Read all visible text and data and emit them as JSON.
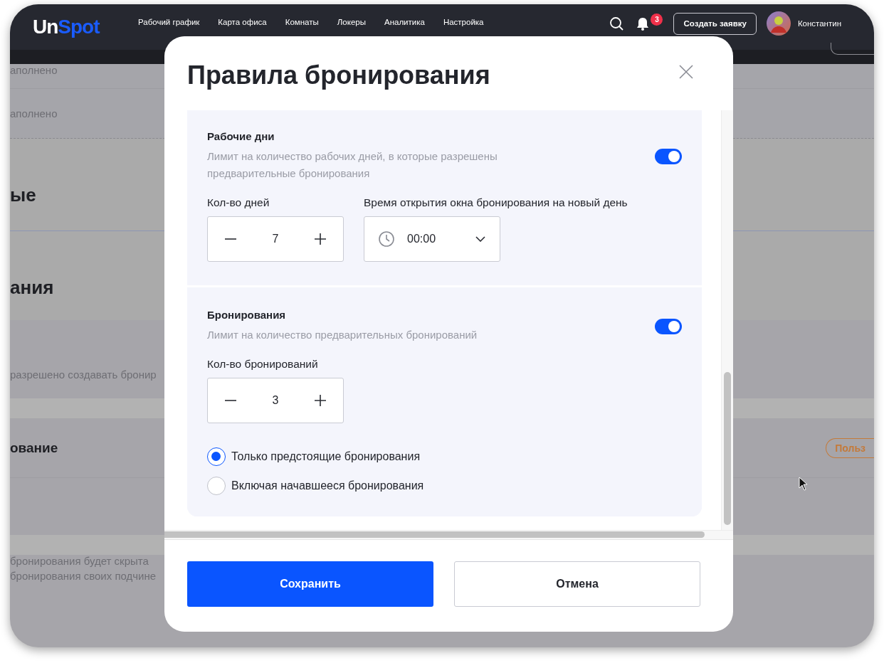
{
  "header": {
    "logo": {
      "first": "Un",
      "second": "Spot"
    },
    "nav": [
      {
        "label": "Рабочий график"
      },
      {
        "label": "Карта офиса"
      },
      {
        "label": "Комнаты"
      },
      {
        "label": "Локеры"
      },
      {
        "label": "Аналитика"
      },
      {
        "label": "Настройка"
      }
    ],
    "notification_count": "3",
    "create_button": "Создать заявку",
    "user_name": "Константин"
  },
  "background": {
    "rows": [
      {
        "kind": "text",
        "text": "аполнено"
      },
      {
        "kind": "text",
        "text": "аполнено"
      },
      {
        "kind": "heading",
        "text": "ые"
      },
      {
        "kind": "heading",
        "text": "ания"
      },
      {
        "kind": "band",
        "text": "разрешено создавать бронир"
      },
      {
        "kind": "strip"
      },
      {
        "kind": "subheading",
        "text": "ование",
        "tag": "Польз"
      },
      {
        "kind": "empty"
      },
      {
        "kind": "strip"
      },
      {
        "kind": "note",
        "lines": [
          "бронирования будет скрыта",
          "бронирования своих подчине"
        ]
      }
    ]
  },
  "dialog": {
    "title": "Правила бронирования",
    "sections": [
      {
        "title": "Рабочие дни",
        "description": "Лимит на количество рабочих дней, в которые разрешены предварительные бронирования",
        "on": true,
        "fields": [
          {
            "kind": "stepper",
            "label": "Кол-во дней",
            "value": "7"
          },
          {
            "kind": "time",
            "label": "Время открытия окна бронирования на новый день",
            "value": "00:00"
          }
        ]
      },
      {
        "title": "Бронирования",
        "description": "Лимит на количество предварительных бронирований",
        "on": true,
        "fields": [
          {
            "kind": "stepper",
            "label": "Кол-во бронирований",
            "value": "3"
          }
        ],
        "options": [
          {
            "label": "Только предстоящие бронирования",
            "selected": true
          },
          {
            "label": "Включая начавшееся бронирования",
            "selected": false
          }
        ]
      }
    ],
    "buttons": [
      {
        "kind": "primary",
        "label": "Сохранить"
      },
      {
        "kind": "secondary",
        "label": "Отмена"
      }
    ]
  }
}
